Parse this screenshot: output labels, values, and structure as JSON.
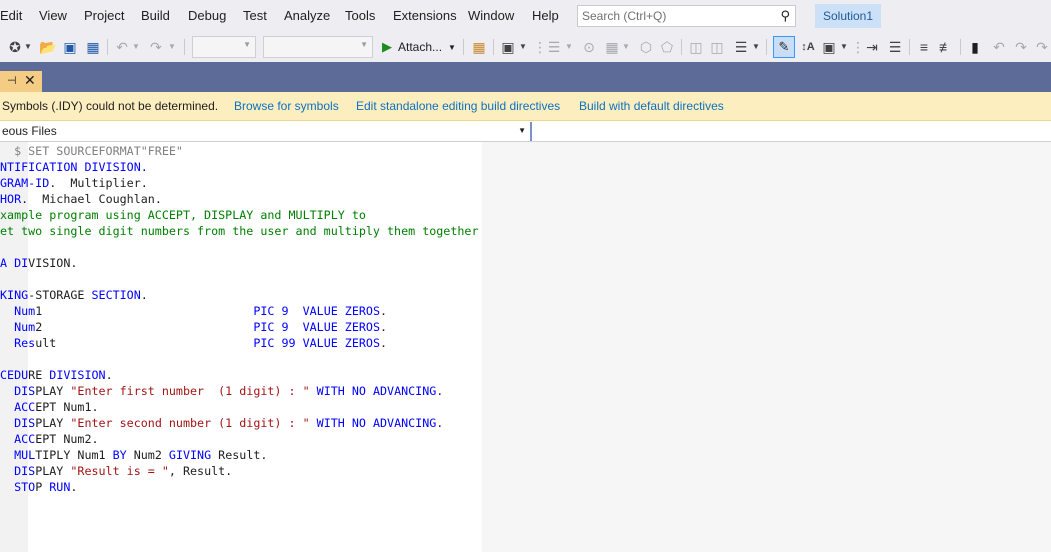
{
  "menu": {
    "items": [
      "Edit",
      "View",
      "Project",
      "Build",
      "Debug",
      "Test",
      "Analyze",
      "Tools",
      "Extensions",
      "Window",
      "Help"
    ]
  },
  "search": {
    "placeholder": "Search (Ctrl+Q)",
    "icon": "search-icon"
  },
  "solution": {
    "label": "Solution1"
  },
  "toolbar": {
    "attach_label": "Attach...",
    "icons": [
      "new-project-icon",
      "open-folder-icon",
      "save-icon",
      "save-all-icon",
      "undo-icon",
      "redo-icon",
      "play-icon",
      "find-icon",
      "browser-icon",
      "bookmark-icon",
      "comment-icon",
      "uncomment-icon",
      "pen-icon",
      "font-size-icon",
      "format-icon"
    ]
  },
  "tab": {
    "pin_icon": "pin-icon",
    "close_icon": "close-icon"
  },
  "infobar": {
    "message": "Symbols (.IDY) could not be determined.",
    "links": [
      "Browse for symbols",
      "Edit standalone editing build directives",
      "Build with default directives"
    ]
  },
  "navbar": {
    "project": "eous Files"
  },
  "colors": {
    "keyword": "#0000ff",
    "string": "#a31515",
    "comment": "#008000",
    "tab_active": "#f5cc84",
    "tab_strip": "#5d6b99",
    "infobar": "#fdeec0",
    "link": "#0e70c0"
  },
  "code": {
    "lines": [
      [
        [
          "dir",
          "  $ SET SOURCEFORMAT\"FREE\""
        ]
      ],
      [
        [
          "kw",
          "NTIFICATION DIVISION."
        ]
      ],
      [
        [
          "kw",
          "GRAM-ID"
        ],
        [
          "txt",
          ".  Multiplier."
        ]
      ],
      [
        [
          "kw",
          "HOR"
        ],
        [
          "txt",
          ".  Michael Coughlan."
        ]
      ],
      [
        [
          "cmt",
          "xample program using ACCEPT, DISPLAY and MULTIPLY to"
        ]
      ],
      [
        [
          "cmt",
          "et two single digit numbers from the user and multiply them together"
        ]
      ],
      [],
      [
        [
          "kw",
          "A DI"
        ],
        [
          "txt",
          "VISION."
        ]
      ],
      [],
      [
        [
          "kw",
          "KING"
        ],
        [
          "txt",
          "-STORAGE "
        ],
        [
          "kw",
          "SECTION"
        ],
        [
          "txt",
          "."
        ]
      ],
      [
        [
          "kw",
          "  Num"
        ],
        [
          "txt",
          "1                              "
        ],
        [
          "kw",
          "PIC 9  VALUE ZEROS"
        ],
        [
          "txt",
          "."
        ]
      ],
      [
        [
          "kw",
          "  Num"
        ],
        [
          "txt",
          "2                              "
        ],
        [
          "kw",
          "PIC 9  VALUE ZEROS"
        ],
        [
          "txt",
          "."
        ]
      ],
      [
        [
          "kw",
          "  Res"
        ],
        [
          "txt",
          "ult                            "
        ],
        [
          "kw",
          "PIC 99 VALUE ZEROS"
        ],
        [
          "txt",
          "."
        ]
      ],
      [],
      [
        [
          "kw",
          "CEDU"
        ],
        [
          "txt",
          "RE "
        ],
        [
          "kw",
          "DIVISION"
        ],
        [
          "txt",
          "."
        ]
      ],
      [
        [
          "kw",
          "  DIS"
        ],
        [
          "txt",
          "PLAY "
        ],
        [
          "str",
          "\"Enter first number  (1 digit) : \""
        ],
        [
          "txt",
          " "
        ],
        [
          "kw",
          "WITH NO ADVANCING"
        ],
        [
          "txt",
          "."
        ]
      ],
      [
        [
          "kw",
          "  ACC"
        ],
        [
          "txt",
          "EPT Num1."
        ]
      ],
      [
        [
          "kw",
          "  DIS"
        ],
        [
          "txt",
          "PLAY "
        ],
        [
          "str",
          "\"Enter second number (1 digit) : \""
        ],
        [
          "txt",
          " "
        ],
        [
          "kw",
          "WITH NO ADVANCING"
        ],
        [
          "txt",
          "."
        ]
      ],
      [
        [
          "kw",
          "  ACC"
        ],
        [
          "txt",
          "EPT Num2."
        ]
      ],
      [
        [
          "kw",
          "  MUL"
        ],
        [
          "txt",
          "TIPLY Num1 "
        ],
        [
          "kw",
          "BY"
        ],
        [
          "txt",
          " Num2 "
        ],
        [
          "kw",
          "GIVING"
        ],
        [
          "txt",
          " Result."
        ]
      ],
      [
        [
          "kw",
          "  DIS"
        ],
        [
          "txt",
          "PLAY "
        ],
        [
          "str",
          "\"Result is = \""
        ],
        [
          "txt",
          ", Result."
        ]
      ],
      [
        [
          "kw",
          "  STO"
        ],
        [
          "txt",
          "P "
        ],
        [
          "kw",
          "RUN"
        ],
        [
          "txt",
          "."
        ]
      ]
    ]
  }
}
